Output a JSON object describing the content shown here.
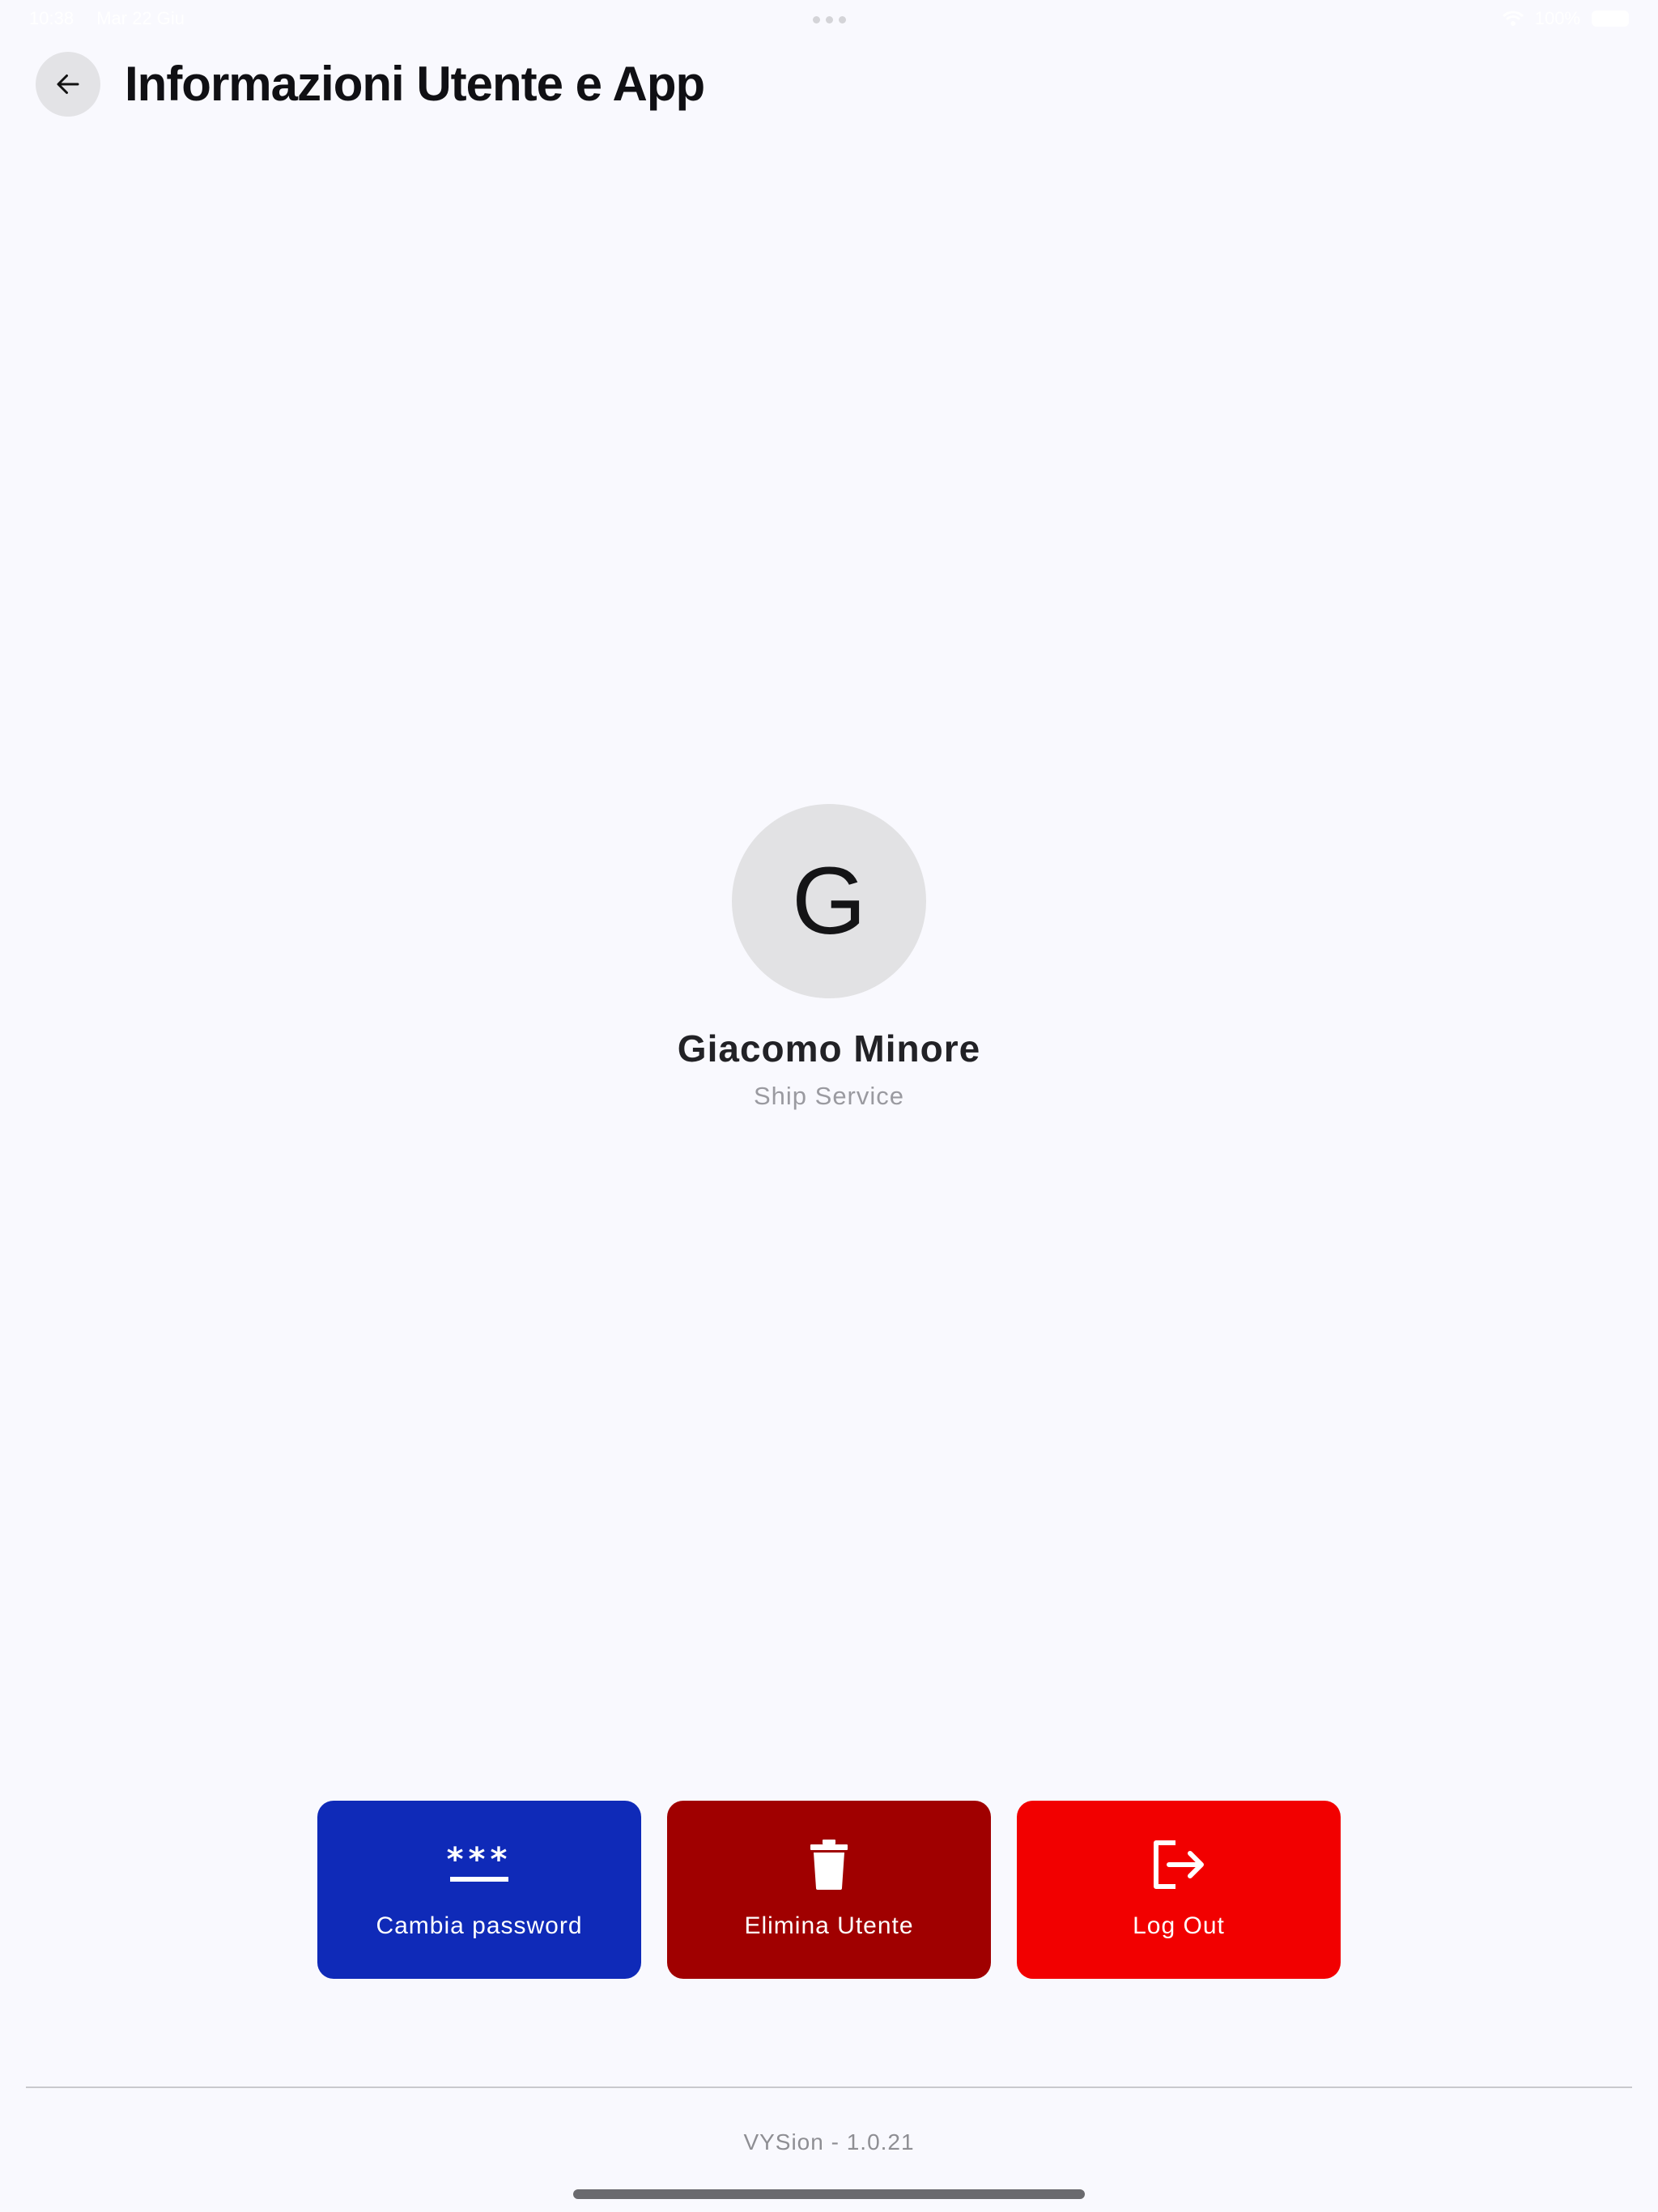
{
  "status_bar": {
    "time": "10:38",
    "date": "Mar 22 Giu",
    "battery": "100%"
  },
  "header": {
    "back_icon": "arrow-left-icon",
    "title": "Informazioni Utente e App"
  },
  "profile": {
    "avatar_initial": "G",
    "name": "Giacomo Minore",
    "role": "Ship Service"
  },
  "actions": [
    {
      "label": "Cambia password",
      "icon": "password-icon",
      "color": "#0f2ab8"
    },
    {
      "label": "Elimina Utente",
      "icon": "trash-icon",
      "color": "#a00000"
    },
    {
      "label": "Log Out",
      "icon": "logout-icon",
      "color": "#f20000"
    }
  ],
  "footer": {
    "version": "VYSion - 1.0.21"
  },
  "colors": {
    "background": "#f9f9fe",
    "avatar_bg": "#e2e2e4"
  }
}
